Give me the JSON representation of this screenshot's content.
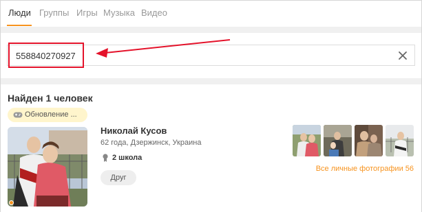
{
  "tabs": [
    {
      "label": "Люди",
      "active": true
    },
    {
      "label": "Группы",
      "active": false
    },
    {
      "label": "Игры",
      "active": false
    },
    {
      "label": "Музыка",
      "active": false
    },
    {
      "label": "Видео",
      "active": false
    }
  ],
  "search": {
    "value": "558840270927"
  },
  "results": {
    "title": "Найден 1 человек",
    "badge": "Обновление ...",
    "user": {
      "name": "Николай Кусов",
      "info": "62 года, Дзержинск, Украина",
      "school": "2 школа",
      "friend_label": "Друг",
      "photos_link": "Все личные фотографии 56"
    }
  },
  "colors": {
    "accent": "#f7931e",
    "annotation": "#e4122a"
  },
  "icons": {
    "clear": "close-icon",
    "badge": "gamepad-icon",
    "school": "graduation-icon"
  }
}
